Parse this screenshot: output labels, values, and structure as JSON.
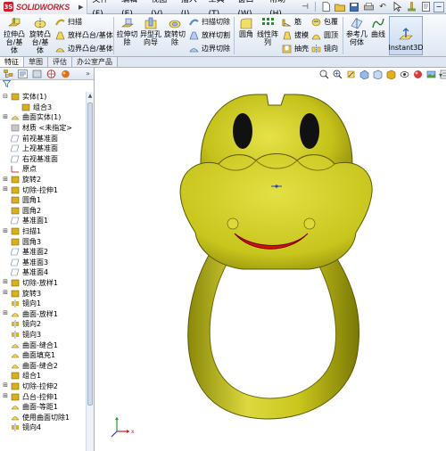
{
  "app": {
    "brand": "SOLIDWORKS",
    "brand_prefix": "3S"
  },
  "menu": [
    "文件(F)",
    "编辑(E)",
    "视图(V)",
    "插入(I)",
    "工具(T)",
    "窗口(W)",
    "帮助(H)"
  ],
  "ribbon": {
    "extrude_boss": "拉伸凸\n台/基\n体",
    "revolve_boss": "旋转凸\n台/基\n体",
    "sweep": "扫描",
    "loft_boss": "放样凸台/基体",
    "boundary_boss": "边界凸台/基体",
    "extrude_cut": "拉伸切\n除",
    "hole_wizard": "异型孔\n向导",
    "revolve_cut": "旋转切\n除",
    "swept_cut": "扫描切除",
    "lofted_cut": "放样切割",
    "boundary_cut": "边界切除",
    "fillet": "圆角",
    "linear_pattern": "线性阵\n列",
    "rib": "筋",
    "draft": "拔模",
    "shell": "抽壳",
    "wrap": "包覆",
    "dome": "圆顶",
    "mirror": "镜向",
    "ref_geometry": "参考几\n何体",
    "curves": "曲线",
    "instant3d": "Instant3D"
  },
  "tabs": [
    "特征",
    "草图",
    "评估",
    "办公室产品"
  ],
  "tree": [
    {
      "label": "实体(1)",
      "exp": "⊟",
      "indent": 0
    },
    {
      "label": "组合3",
      "exp": "",
      "indent": 1
    },
    {
      "label": "曲面实体(1)",
      "exp": "⊞",
      "indent": 0
    },
    {
      "label": "材质 <未指定>",
      "exp": "",
      "indent": 0
    },
    {
      "label": "前视基准面",
      "exp": "",
      "indent": 0
    },
    {
      "label": "上视基准面",
      "exp": "",
      "indent": 0
    },
    {
      "label": "右视基准面",
      "exp": "",
      "indent": 0
    },
    {
      "label": "原点",
      "exp": "",
      "indent": 0
    },
    {
      "label": "旋转2",
      "exp": "⊞",
      "indent": 0
    },
    {
      "label": "切除-拉伸1",
      "exp": "⊞",
      "indent": 0
    },
    {
      "label": "圆角1",
      "exp": "",
      "indent": 0
    },
    {
      "label": "圆角2",
      "exp": "",
      "indent": 0
    },
    {
      "label": "基准面1",
      "exp": "",
      "indent": 0
    },
    {
      "label": "扫描1",
      "exp": "⊞",
      "indent": 0
    },
    {
      "label": "圆角3",
      "exp": "",
      "indent": 0
    },
    {
      "label": "基准面2",
      "exp": "",
      "indent": 0
    },
    {
      "label": "基准面3",
      "exp": "",
      "indent": 0
    },
    {
      "label": "基准面4",
      "exp": "",
      "indent": 0
    },
    {
      "label": "切除-放样1",
      "exp": "⊞",
      "indent": 0
    },
    {
      "label": "旋转3",
      "exp": "⊞",
      "indent": 0
    },
    {
      "label": "镜向1",
      "exp": "",
      "indent": 0
    },
    {
      "label": "曲面-放样1",
      "exp": "⊞",
      "indent": 0
    },
    {
      "label": "镜向2",
      "exp": "",
      "indent": 0
    },
    {
      "label": "镜向3",
      "exp": "",
      "indent": 0
    },
    {
      "label": "曲面-缝合1",
      "exp": "",
      "indent": 0
    },
    {
      "label": "曲面填充1",
      "exp": "",
      "indent": 0
    },
    {
      "label": "曲面-缝合2",
      "exp": "",
      "indent": 0
    },
    {
      "label": "组合1",
      "exp": "",
      "indent": 0
    },
    {
      "label": "切除-拉伸2",
      "exp": "⊞",
      "indent": 0
    },
    {
      "label": "凸台-拉伸1",
      "exp": "⊞",
      "indent": 0
    },
    {
      "label": "曲面-等距1",
      "exp": "",
      "indent": 0
    },
    {
      "label": "使用曲面切除1",
      "exp": "",
      "indent": 0
    },
    {
      "label": "镜向4",
      "exp": "",
      "indent": 0
    }
  ],
  "colors": {
    "model_yellow": "#c8c61a",
    "model_dark": "#6e6c06",
    "eye": "#111111",
    "mouth": "#d11010",
    "tree_icon": "#d8b020"
  }
}
